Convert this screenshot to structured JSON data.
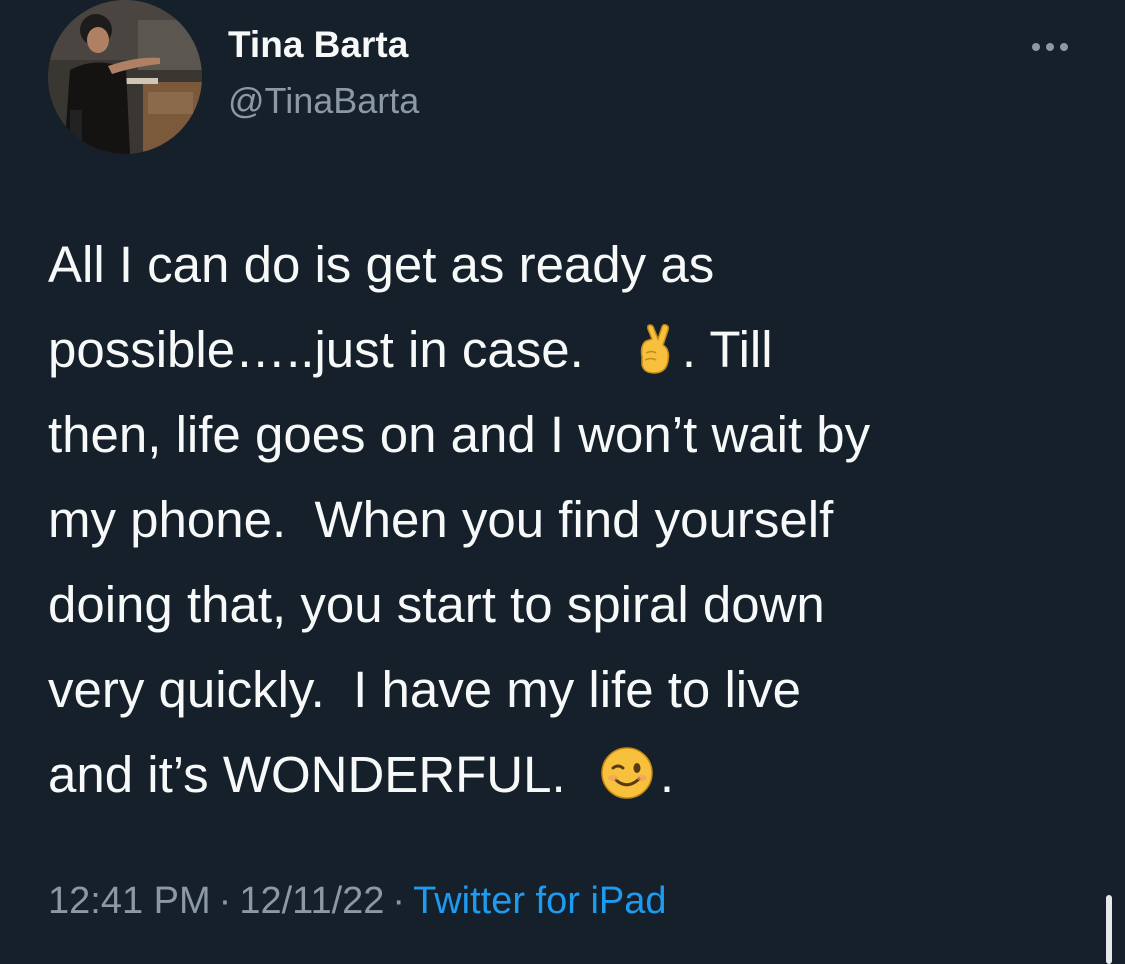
{
  "author": {
    "name": "Tina Barta",
    "handle": "@TinaBarta",
    "avatar_icon": "profile-photo"
  },
  "more_icon": "ellipsis-icon",
  "tweet": {
    "lines": [
      {
        "text": "All I can do is get as ready as"
      },
      {
        "text": "possible…..just in case.",
        "emoji": "crossed-fingers",
        "after": ". Till"
      },
      {
        "text": "then, life goes on and I won’t wait by"
      },
      {
        "text": "my phone.  When you find yourself"
      },
      {
        "text": "doing that, you start to spiral down"
      },
      {
        "text": "very quickly.  I have my life to live"
      },
      {
        "text": "and it’s WONDERFUL.",
        "emoji": "winking-face",
        "after": "."
      }
    ]
  },
  "meta": {
    "time": "12:41 PM",
    "separator": "·",
    "date": "12/11/22",
    "source": "Twitter for iPad"
  },
  "colors": {
    "background": "#15202b",
    "text": "#f7f9f9",
    "secondary": "#8b98a5",
    "link": "#1d9bf0"
  }
}
